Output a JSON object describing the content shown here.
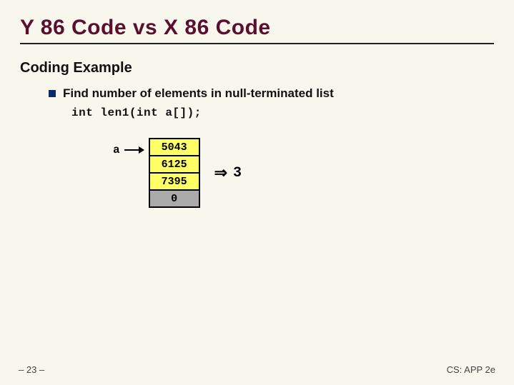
{
  "title": "Y 86 Code vs X 86 Code",
  "subhead": "Coding Example",
  "bullet": "Find number of elements in null-terminated list",
  "code": "int len1(int a[]);",
  "array_label": "a",
  "cells": [
    "5043",
    "6125",
    "7395",
    "0"
  ],
  "result_arrow": "⇒",
  "result_value": "3",
  "footer_left": "– 23 –",
  "footer_right": "CS: APP 2e"
}
